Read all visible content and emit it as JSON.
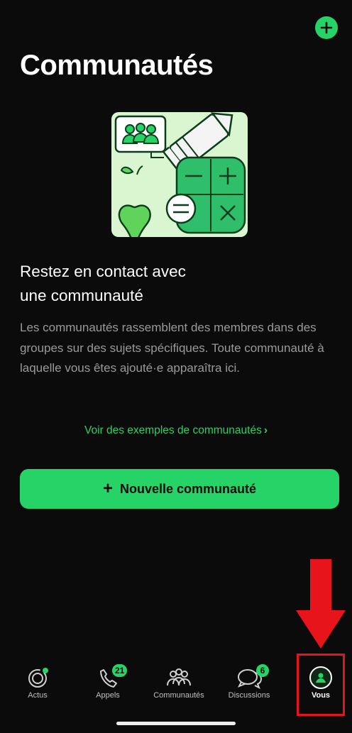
{
  "header": {
    "title": "Communautés",
    "add_icon": "plus-icon"
  },
  "empty_state": {
    "heading_line1": "Restez en contact avec",
    "heading_line2": "une communauté",
    "description": "Les communautés rassemblent des membres dans des groupes sur des sujets spécifiques. Toute communauté à laquelle vous êtes ajouté·e apparaîtra ici.",
    "examples_link": "Voir des exemples de communautés",
    "new_button": "Nouvelle communauté"
  },
  "tabs": [
    {
      "label": "Actus",
      "icon": "status-icon"
    },
    {
      "label": "Appels",
      "icon": "phone-icon",
      "badge": "21"
    },
    {
      "label": "Communautés",
      "icon": "community-icon"
    },
    {
      "label": "Discussions",
      "icon": "chats-icon",
      "badge": "6"
    },
    {
      "label": "Vous",
      "icon": "profile-icon",
      "active": true
    }
  ],
  "colors": {
    "accent": "#25d366",
    "background": "#0b0b0b",
    "annotation": "#e8141c",
    "illustration_bg": "#d9f6d0"
  }
}
